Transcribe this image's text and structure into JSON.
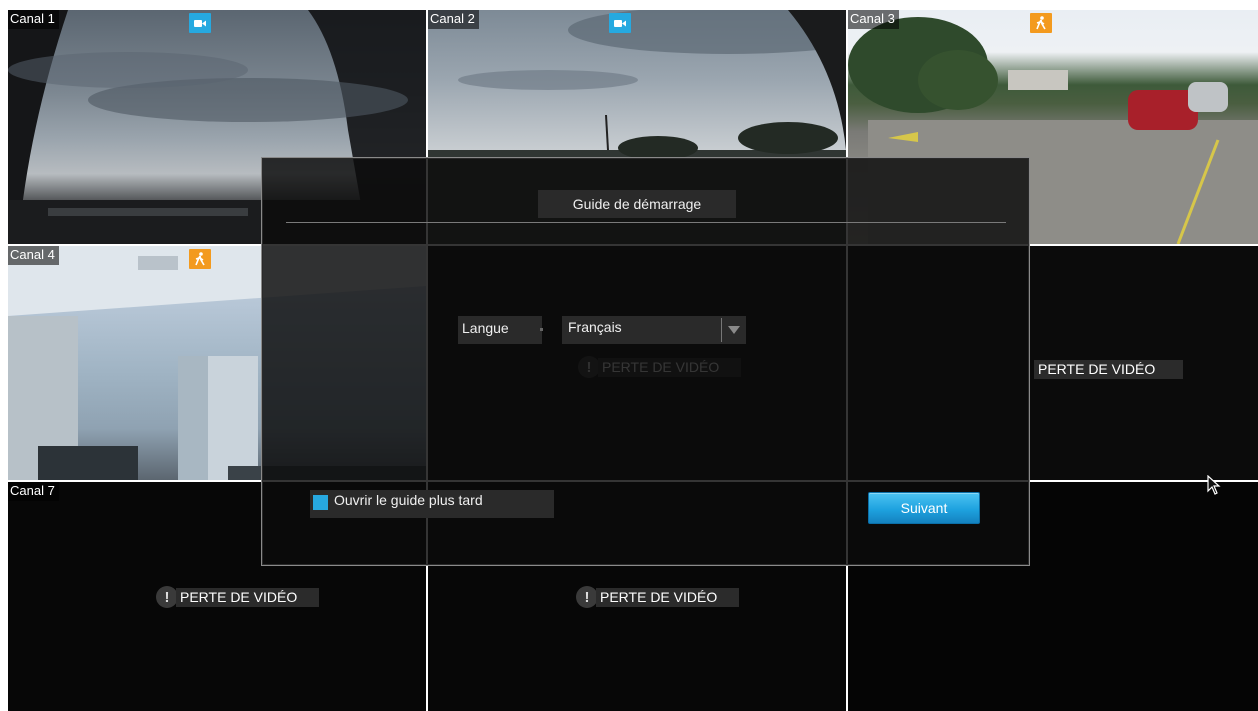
{
  "channels": [
    {
      "label": "Canal 1",
      "badge": "camera-icon",
      "state": "live"
    },
    {
      "label": "Canal 2",
      "badge": "camera-icon",
      "state": "live"
    },
    {
      "label": "Canal 3",
      "badge": "motion-icon",
      "state": "live"
    },
    {
      "label": "Canal 4",
      "badge": "motion-icon",
      "state": "live"
    },
    {
      "label": "",
      "state": "video-loss"
    },
    {
      "label": "",
      "state": "video-loss"
    },
    {
      "label": "Canal 7",
      "state": "video-loss"
    },
    {
      "label": "",
      "state": "video-loss"
    },
    {
      "label": "",
      "state": "no-signal"
    }
  ],
  "video_loss_text": "PERTE DE VIDÉO",
  "video_loss_icon": "exclamation-icon",
  "dialog": {
    "title": "Guide de démarrage",
    "language_label": "Langue",
    "language_value": "Français",
    "open_later_label": "Ouvrir le guide plus tard",
    "open_later_checked": true,
    "next_label": "Suivant"
  },
  "colors": {
    "accent": "#26a9e0",
    "motion_badge": "#f39a1e",
    "panel": "#2a2a2a"
  }
}
